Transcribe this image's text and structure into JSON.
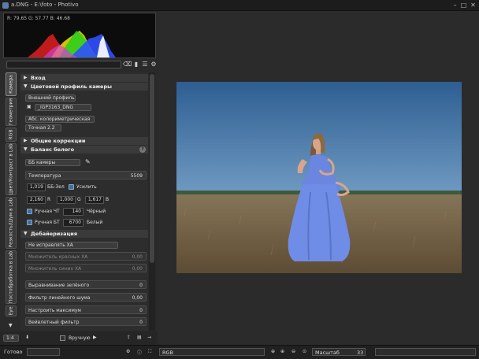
{
  "window": {
    "title": "a.DNG - E:\\foto - Photivo",
    "minimize": "–",
    "maximize": "□",
    "close": "✕"
  },
  "histogram": {
    "readout": "R: 79.65  G: 57.77  B: 46.68"
  },
  "search": {
    "value": ""
  },
  "tabs": [
    {
      "label": "Камера"
    },
    {
      "label": "Геометрия"
    },
    {
      "label": "RGB"
    },
    {
      "label": "Цвет/Контраст в Lab"
    },
    {
      "label": "Резкость/Шум в Lab"
    },
    {
      "label": "Постобработка в Lab"
    },
    {
      "label": "Eye"
    }
  ],
  "panel": {
    "sections": {
      "input": "Вход",
      "camera_profile": "Цветовой профиль камеры",
      "general": "Общие коррекции",
      "white_balance": "Баланс белого",
      "demosaic": "Дебайеризация"
    },
    "camera_profile": {
      "source": "Внешний профиль",
      "file": "_IGP3163_DNG",
      "intent": "Абс. колориметрическая",
      "gamma": "Точная 2.2"
    },
    "white_balance": {
      "preset": "ББ камеры",
      "temperature_label": "Температура",
      "temperature_value": "5509",
      "green_value": "1,019",
      "green_label": "ББ-Зел",
      "boost_label": "Усилить",
      "r_value": "2,160",
      "r_label": "R",
      "g_value": "1,000",
      "g_label": "G",
      "b_value": "1,617",
      "b_label": "B",
      "black_label": "Ручная ЧТ",
      "black_value": "140",
      "black_suffix": "Чёрный",
      "white_label": "Ручная БТ",
      "white_value": "6700",
      "white_suffix": "Белый"
    },
    "demosaic": {
      "ca_mode": "Не исправлять ХА",
      "red_ca_label": "Множитель красных ХА",
      "red_ca_value": "0,00",
      "blue_ca_label": "Множитель синих ХА",
      "blue_ca_value": "0,00",
      "green_eq_label": "Выравнивание зелёного",
      "green_eq_value": "0",
      "line_noise_label": "Фильтр линейного шума",
      "line_noise_value": "0,00",
      "max_label": "Настроить максимум",
      "max_value": "0",
      "wavelet_label": "Вейвлетный фильтр",
      "wavelet_value": "0"
    }
  },
  "footer": {
    "scale": "1:4",
    "manual_label": "Вручную"
  },
  "status": {
    "ready": "Готово",
    "mode": "RGB",
    "zoom_label": "Масштаб",
    "zoom_value": "33"
  },
  "colors": {
    "accent": "#3e6ea8",
    "background": "#2b2b2b"
  }
}
